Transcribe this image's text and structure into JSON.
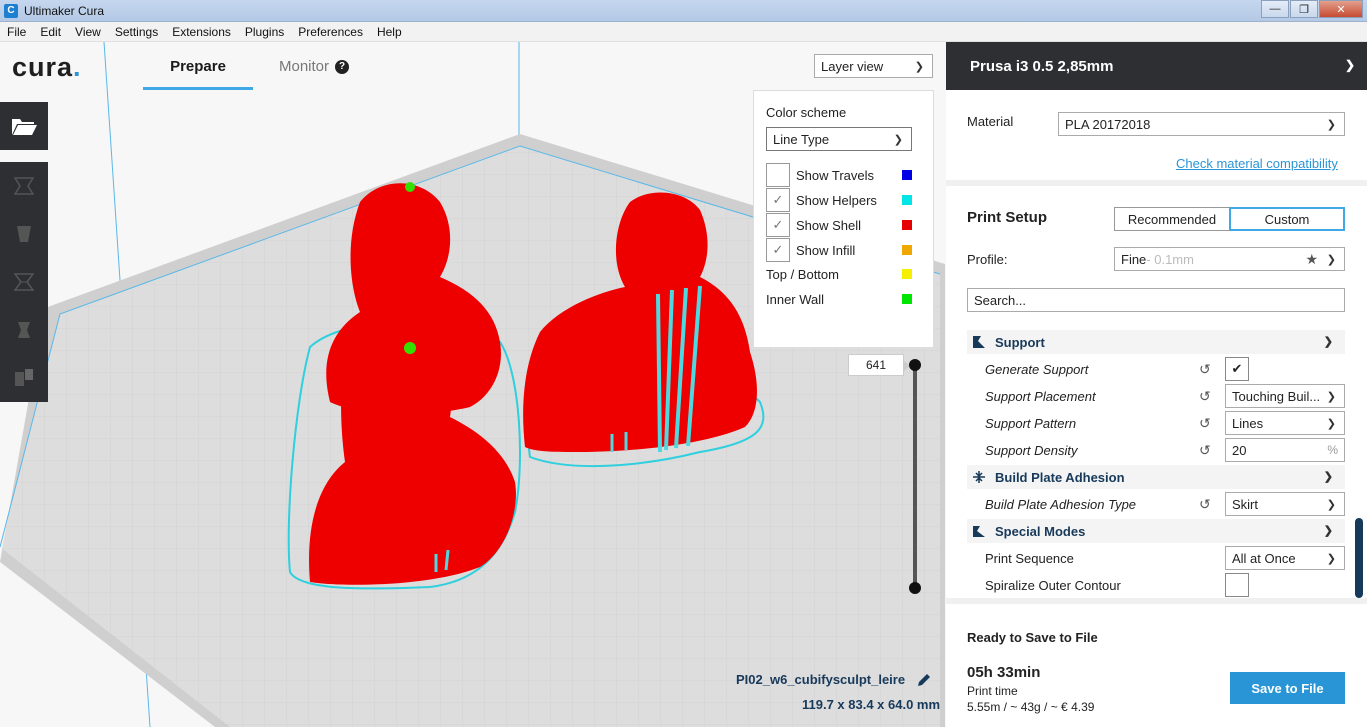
{
  "window": {
    "title": "Ultimaker Cura",
    "icon_letter": "C",
    "minimize": "—",
    "maximize": "❐",
    "close": "✕"
  },
  "menu": [
    "File",
    "Edit",
    "View",
    "Settings",
    "Extensions",
    "Plugins",
    "Preferences",
    "Help"
  ],
  "header": {
    "logo": "cura",
    "logo_dot": ".",
    "tab_prepare": "Prepare",
    "tab_monitor": "Monitor"
  },
  "toolbar": {
    "icons": [
      "open-folder-icon",
      "move-icon",
      "scale-icon",
      "rotate-icon",
      "mirror-icon",
      "per-model-settings-icon"
    ]
  },
  "view": {
    "mode": "Layer view"
  },
  "color_scheme": {
    "title": "Color scheme",
    "selected": "Line Type",
    "items": [
      {
        "label": "Show Travels",
        "checkbox": true,
        "checked": false,
        "color": "#0000e6"
      },
      {
        "label": "Show Helpers",
        "checkbox": true,
        "checked": true,
        "color": "#00e6e6"
      },
      {
        "label": "Show Shell",
        "checkbox": true,
        "checked": true,
        "color": "#e60000"
      },
      {
        "label": "Show Infill",
        "checkbox": true,
        "checked": true,
        "color": "#f0a800"
      },
      {
        "label": "Top / Bottom",
        "checkbox": false,
        "checked": false,
        "color": "#f5f000"
      },
      {
        "label": "Inner Wall",
        "checkbox": false,
        "checked": false,
        "color": "#00e600"
      }
    ]
  },
  "layer": {
    "current": "641"
  },
  "job": {
    "name": "PI02_w6_cubifysculpt_leire",
    "dimensions": "119.7 x 83.4 x 64.0 mm"
  },
  "printer": {
    "name": "Prusa i3 0.5 2,85mm"
  },
  "material": {
    "label": "Material",
    "value": "PLA 20172018",
    "link": "Check material compatibility"
  },
  "print_setup": {
    "title": "Print Setup",
    "recommended": "Recommended",
    "custom": "Custom",
    "profile_label": "Profile:",
    "profile_value": "Fine",
    "profile_hint": " - 0.1mm",
    "search_placeholder": "Search..."
  },
  "settings": {
    "support": {
      "title": "Support",
      "generate_support": "Generate Support",
      "generate_support_checked": "✔",
      "placement_label": "Support Placement",
      "placement_value": "Touching Buil...",
      "pattern_label": "Support Pattern",
      "pattern_value": "Lines",
      "density_label": "Support Density",
      "density_value": "20",
      "density_unit": "%"
    },
    "adhesion": {
      "title": "Build Plate Adhesion",
      "type_label": "Build Plate Adhesion Type",
      "type_value": "Skirt"
    },
    "special": {
      "title": "Special Modes",
      "sequence_label": "Print Sequence",
      "sequence_value": "All at Once",
      "spiralize_label": "Spiralize Outer Contour"
    }
  },
  "output": {
    "ready": "Ready to Save to File",
    "time": "05h 33min",
    "time_label": "Print time",
    "cost": "5.55m / ~ 43g / ~ € 4.39",
    "save_button": "Save to File"
  }
}
